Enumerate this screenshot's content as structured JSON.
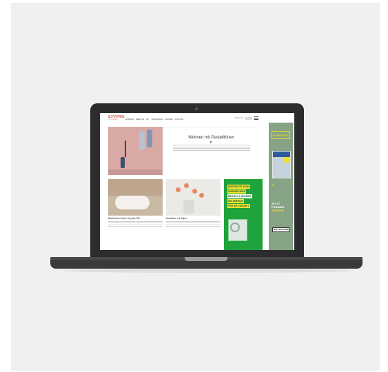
{
  "website": {
    "logo": {
      "line1": "LIVING",
      "line2": "AT HOME"
    },
    "nav": [
      "WOHNEN",
      "REZEPTE",
      "DIY",
      "MAGAZINGIN",
      "GARTEN",
      "COCKTAIL"
    ],
    "header_right": {
      "label": "Melden Sie"
    },
    "hero": {
      "kicker": "",
      "title": "Wohnen mit Pastelltönen",
      "meta": ""
    },
    "cards": [
      {
        "title": "Badezimmer-Ideen für jeden Stil",
        "kicker": "",
        "meta": ""
      },
      {
        "title": "Dekoideen mit Tulpen",
        "kicker": "",
        "meta": ""
      }
    ],
    "ad_inline": {
      "lines": [
        "WER HEUTE SEINE",
        "WÄRMEPUMPE",
        "BESTELLT, SICHERT",
        "DIE ENERGIE",
        "FÜR DIE ZUKUNFT."
      ]
    },
    "ad_side": {
      "brand": "HARDECK.",
      "cta_lines": [
        "JETZT",
        "PRÄMIEN",
        "SICHERN."
      ],
      "button": "JETZT BLÄTTERN"
    }
  },
  "colors": {
    "background": "#eff0f1",
    "laptop": "#2c2c2e",
    "brand_red": "#c0392b",
    "ad_green": "#1fa33d",
    "ad_yellow": "#f1de35",
    "side_ad_bg": "#86a385"
  }
}
